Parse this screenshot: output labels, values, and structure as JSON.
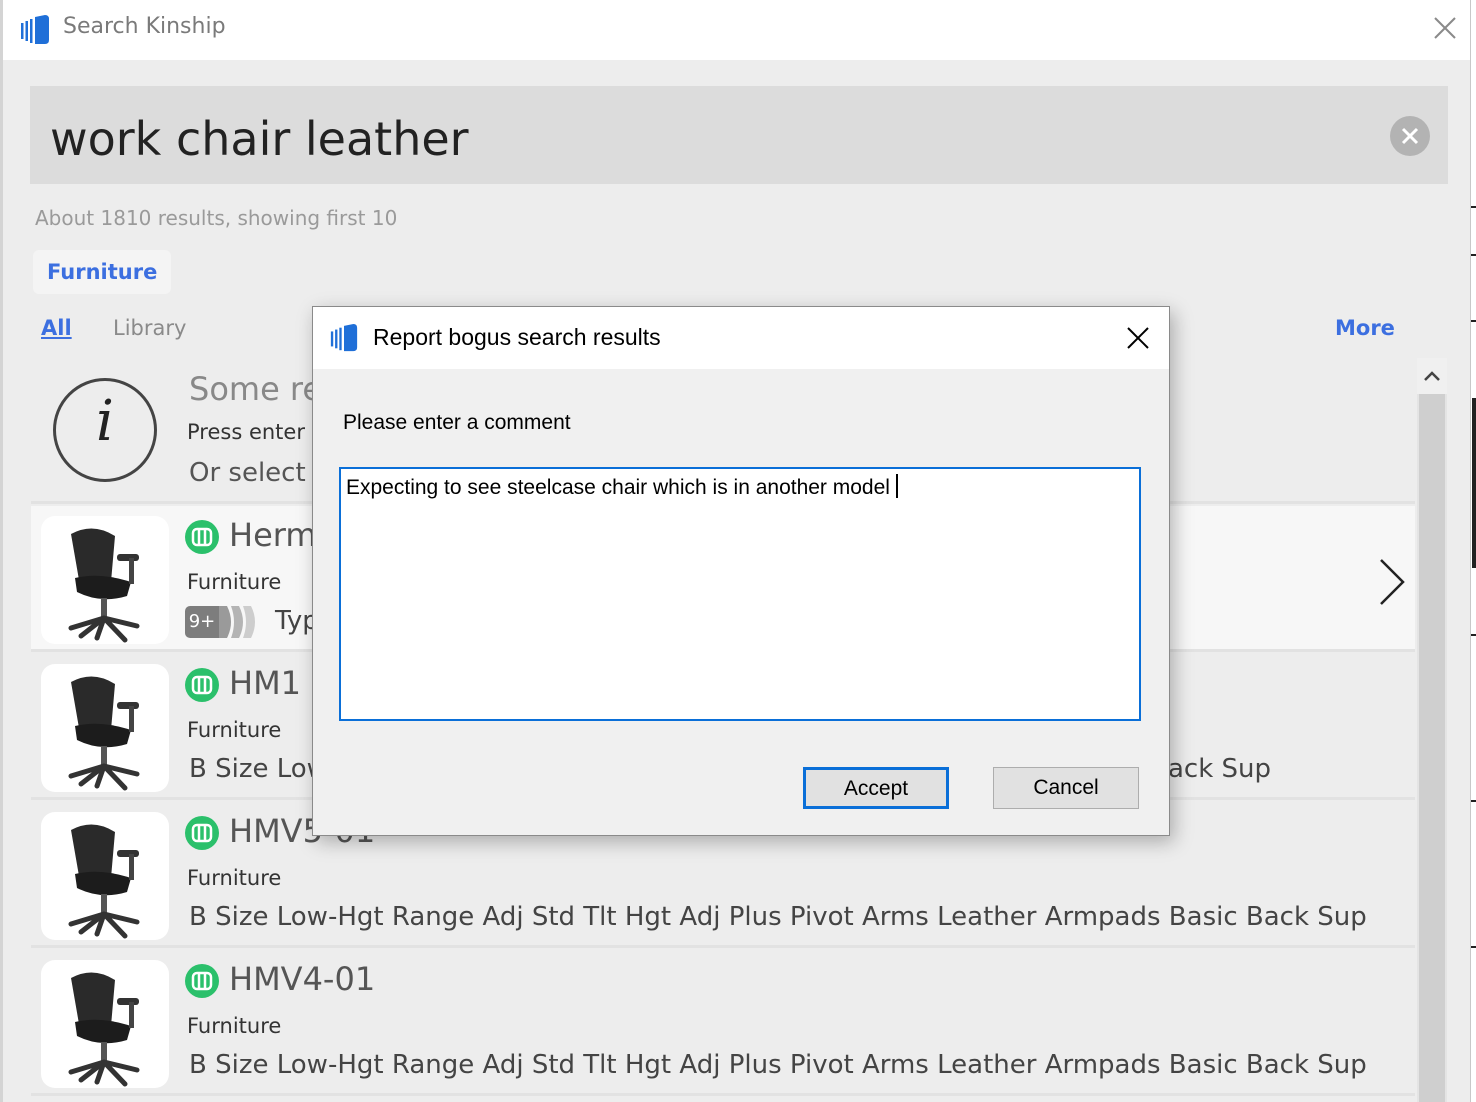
{
  "window": {
    "title": "Search Kinship",
    "close_icon": "close-icon"
  },
  "search": {
    "query": "work chair leather",
    "clear_icon": "clear-circle-icon"
  },
  "results_summary": "About 1810 results, showing first 10",
  "filter_chip": "Furniture",
  "tabs": {
    "all": "All",
    "library": "Library",
    "more": "More"
  },
  "info_item": {
    "title": "Some res",
    "line1": "Press enter o",
    "line2": "Or select a"
  },
  "results": [
    {
      "title": "Herma",
      "category": "Furniture",
      "version_count": "9+",
      "type_text": "Typ",
      "selected": true
    },
    {
      "title": "HM1",
      "category": "Furniture",
      "description": "B Size Low",
      "description_tail": "ack Sup"
    },
    {
      "title": "HMV5-01",
      "category": "Furniture",
      "description": "B Size Low-Hgt Range Adj Std Tlt Hgt Adj Plus Pivot Arms Leather Armpads Basic Back Sup"
    },
    {
      "title": "HMV4-01",
      "category": "Furniture",
      "description": "B Size Low-Hgt Range Adj Std Tlt Hgt Adj Plus Pivot Arms Leather Armpads Basic Back Sup"
    }
  ],
  "dialog": {
    "title": "Report bogus search results",
    "prompt": "Please enter a comment",
    "comment": "Expecting to see steelcase chair which is in another model",
    "accept_label": "Accept",
    "cancel_label": "Cancel"
  },
  "colors": {
    "accent_blue": "#3c6fe0",
    "badge_green": "#2bc06b",
    "focus_blue": "#0a6fd8"
  }
}
